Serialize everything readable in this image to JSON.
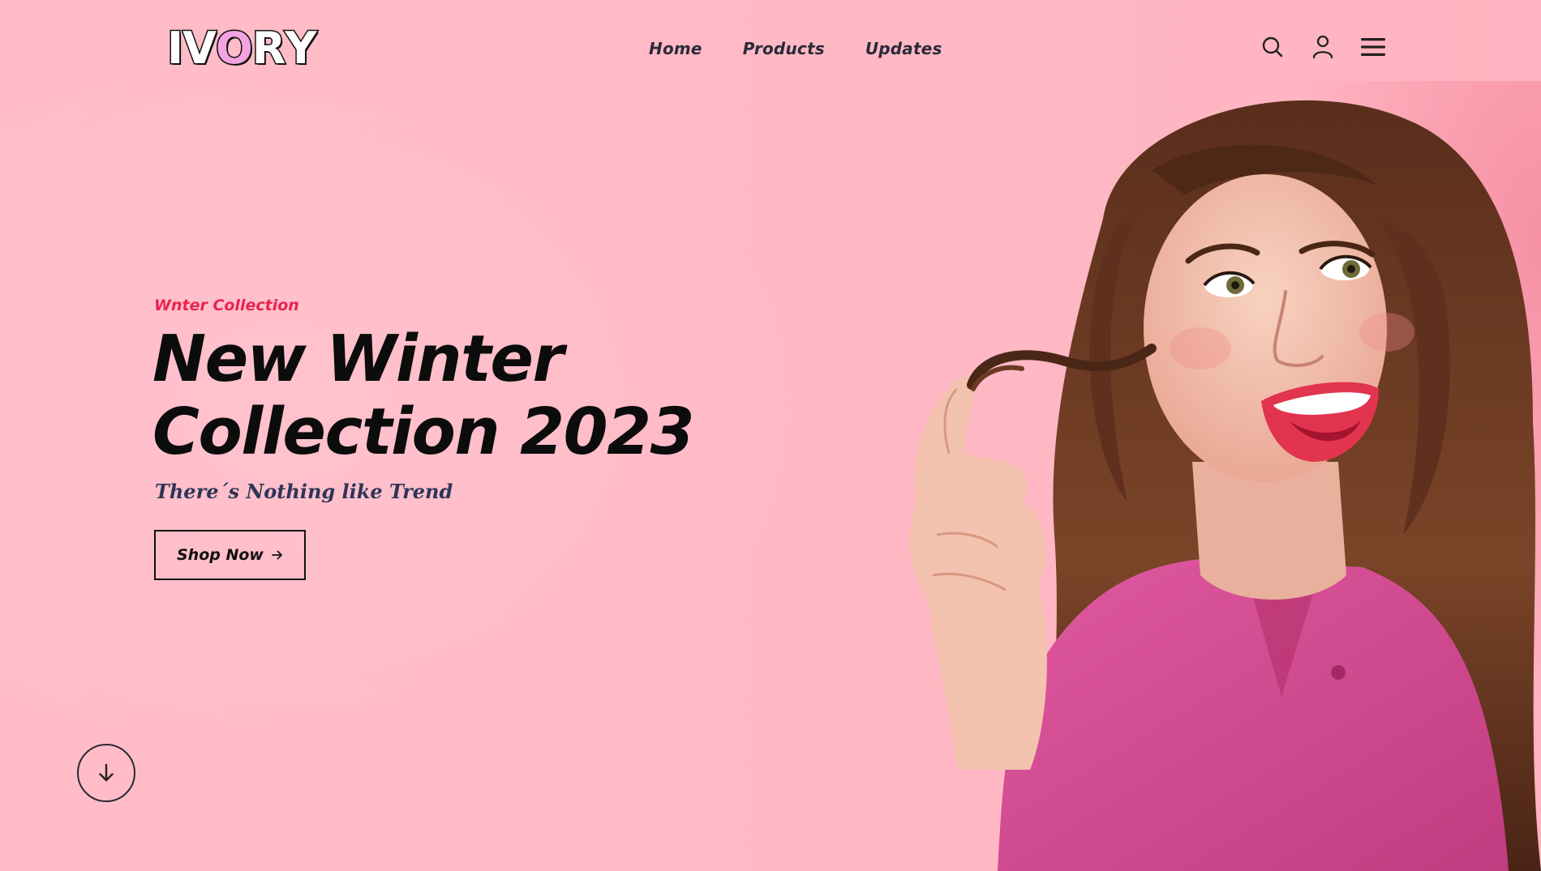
{
  "brand": {
    "logo_text": [
      "I",
      "V",
      "O",
      "R",
      "Y"
    ],
    "accent_letter_index": 2,
    "accent_color": "#f3a3e2"
  },
  "nav": {
    "items": [
      "Home",
      "Products",
      "Updates"
    ]
  },
  "header_icons": [
    "search-icon",
    "user-icon",
    "menu-icon"
  ],
  "hero": {
    "eyebrow": "Wnter Collection",
    "headline_line1": "New Winter",
    "headline_line2": "Collection 2023",
    "tagline": "There´s Nothing like Trend",
    "cta_label": "Shop Now",
    "cta_icon": "arrow-right-icon"
  },
  "scroll_button": {
    "icon": "arrow-down-icon"
  },
  "colors": {
    "background": "#ffbac6",
    "eyebrow": "#e8244f",
    "headline": "#0c0c0c",
    "tagline": "#2e3558",
    "shirt": "#d94a92",
    "hair": "#6b3a25"
  }
}
